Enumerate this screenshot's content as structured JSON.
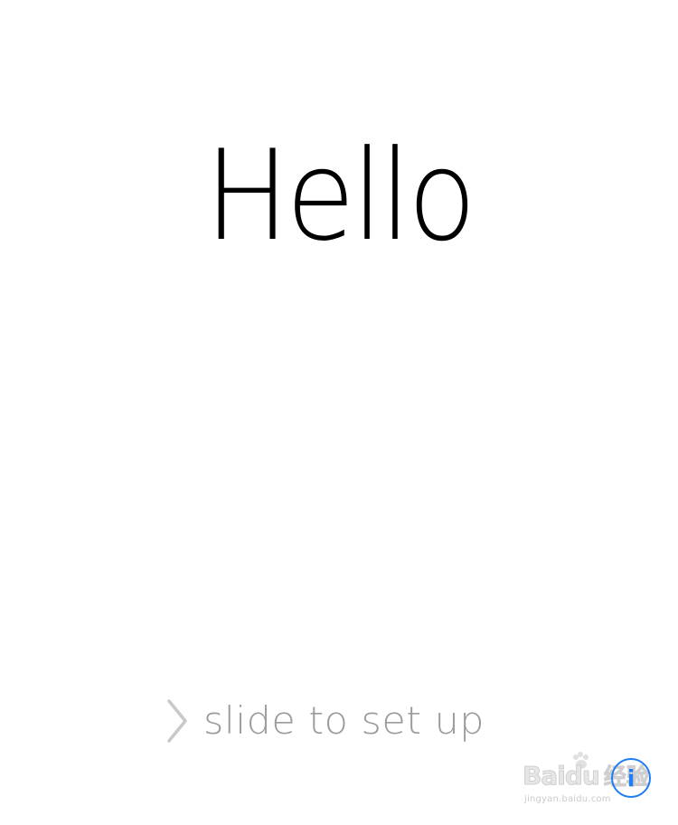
{
  "screen": {
    "greeting": "Hello",
    "slider": {
      "label": "slide to set up"
    },
    "info_button": {
      "glyph": "i",
      "icon": "info-icon"
    },
    "watermark": {
      "brand_prefix": "Bai",
      "brand_suffix": "du",
      "brand_chinese": "经验",
      "url": "jingyan.baidu.com"
    },
    "colors": {
      "background": "#ffffff",
      "greeting": "#000000",
      "slider_text": "#9b9b9b",
      "accent": "#1f7cf5"
    }
  }
}
